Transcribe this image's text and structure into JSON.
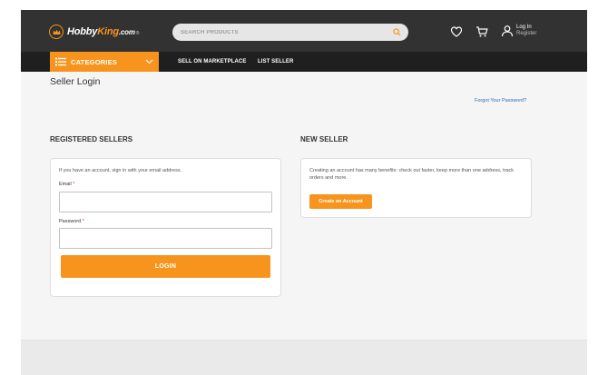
{
  "colors": {
    "accent": "#f7941d",
    "header_bg": "#323232",
    "nav_bg": "#1f1f1f",
    "link": "#2b6fb3"
  },
  "header": {
    "logo": {
      "part1": "Hobby",
      "part2": "King",
      "suffix": ".com",
      "reg": "®"
    },
    "search_placeholder": "SEARCH PRODUCTS",
    "icons": [
      "heart-icon",
      "cart-icon",
      "user-icon"
    ],
    "login": {
      "title": "Log In",
      "subtitle": "Register"
    }
  },
  "nav": {
    "categories_label": "CATEGORIES",
    "links": [
      "SELL ON MARKETPLACE",
      "LIST SELLER"
    ]
  },
  "page": {
    "title": "Seller Login",
    "forgot_password": "Forgot Your Password?"
  },
  "registered": {
    "title": "REGISTERED SELLERS",
    "intro": "If you have an account, sign in with your email address.",
    "email_label": "Email",
    "password_label": "Password",
    "required_mark": "*",
    "login_label": "LOGIN"
  },
  "new_seller": {
    "title": "NEW SELLER",
    "intro": "Creating an account has many benefits: check out faster, keep more than one address, track orders and more.",
    "create_label": "Create an Account"
  }
}
